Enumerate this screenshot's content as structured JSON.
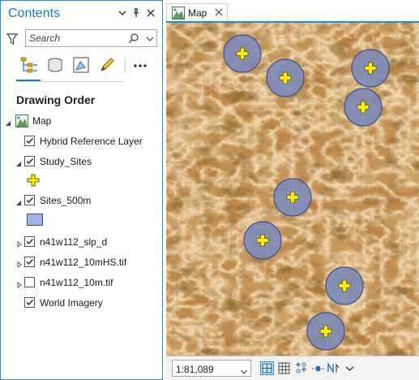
{
  "contents": {
    "title": "Contents",
    "search_placeholder": "Search",
    "heading": "Drawing Order"
  },
  "layers": [
    {
      "label": "Map",
      "expanded": true,
      "checkbox": false,
      "checked": false,
      "icon": "map-icon"
    },
    {
      "label": "Hybrid Reference Layer",
      "expanded": false,
      "checkbox": true,
      "checked": true
    },
    {
      "label": "Study_Sites",
      "expanded": true,
      "checkbox": true,
      "checked": true,
      "symbol": "yellow-cross-symbol"
    },
    {
      "label": "Sites_500m",
      "expanded": true,
      "checkbox": true,
      "checked": true,
      "symbol": "blue-polygon-symbol"
    },
    {
      "label": "n41w112_slp_d",
      "expanded": false,
      "checkbox": true,
      "checked": true
    },
    {
      "label": "n41w112_10mHS.tif",
      "expanded": false,
      "checkbox": true,
      "checked": true
    },
    {
      "label": "n41w112_10m.tif",
      "expanded": false,
      "checkbox": true,
      "checked": false
    },
    {
      "label": "World Imagery",
      "expanded": false,
      "checkbox": true,
      "checked": true
    }
  ],
  "map": {
    "tab_label": "Map",
    "scale": "1:81,089",
    "colors": {
      "terrain_base": "#a0642a",
      "terrain_light": "#e2b679",
      "terrain_dark": "#5e3410",
      "site_fill": "#7a89b8",
      "site_stroke": "#3e4f86",
      "marker": "#ffee00",
      "accent": "#1a7dc4"
    }
  }
}
